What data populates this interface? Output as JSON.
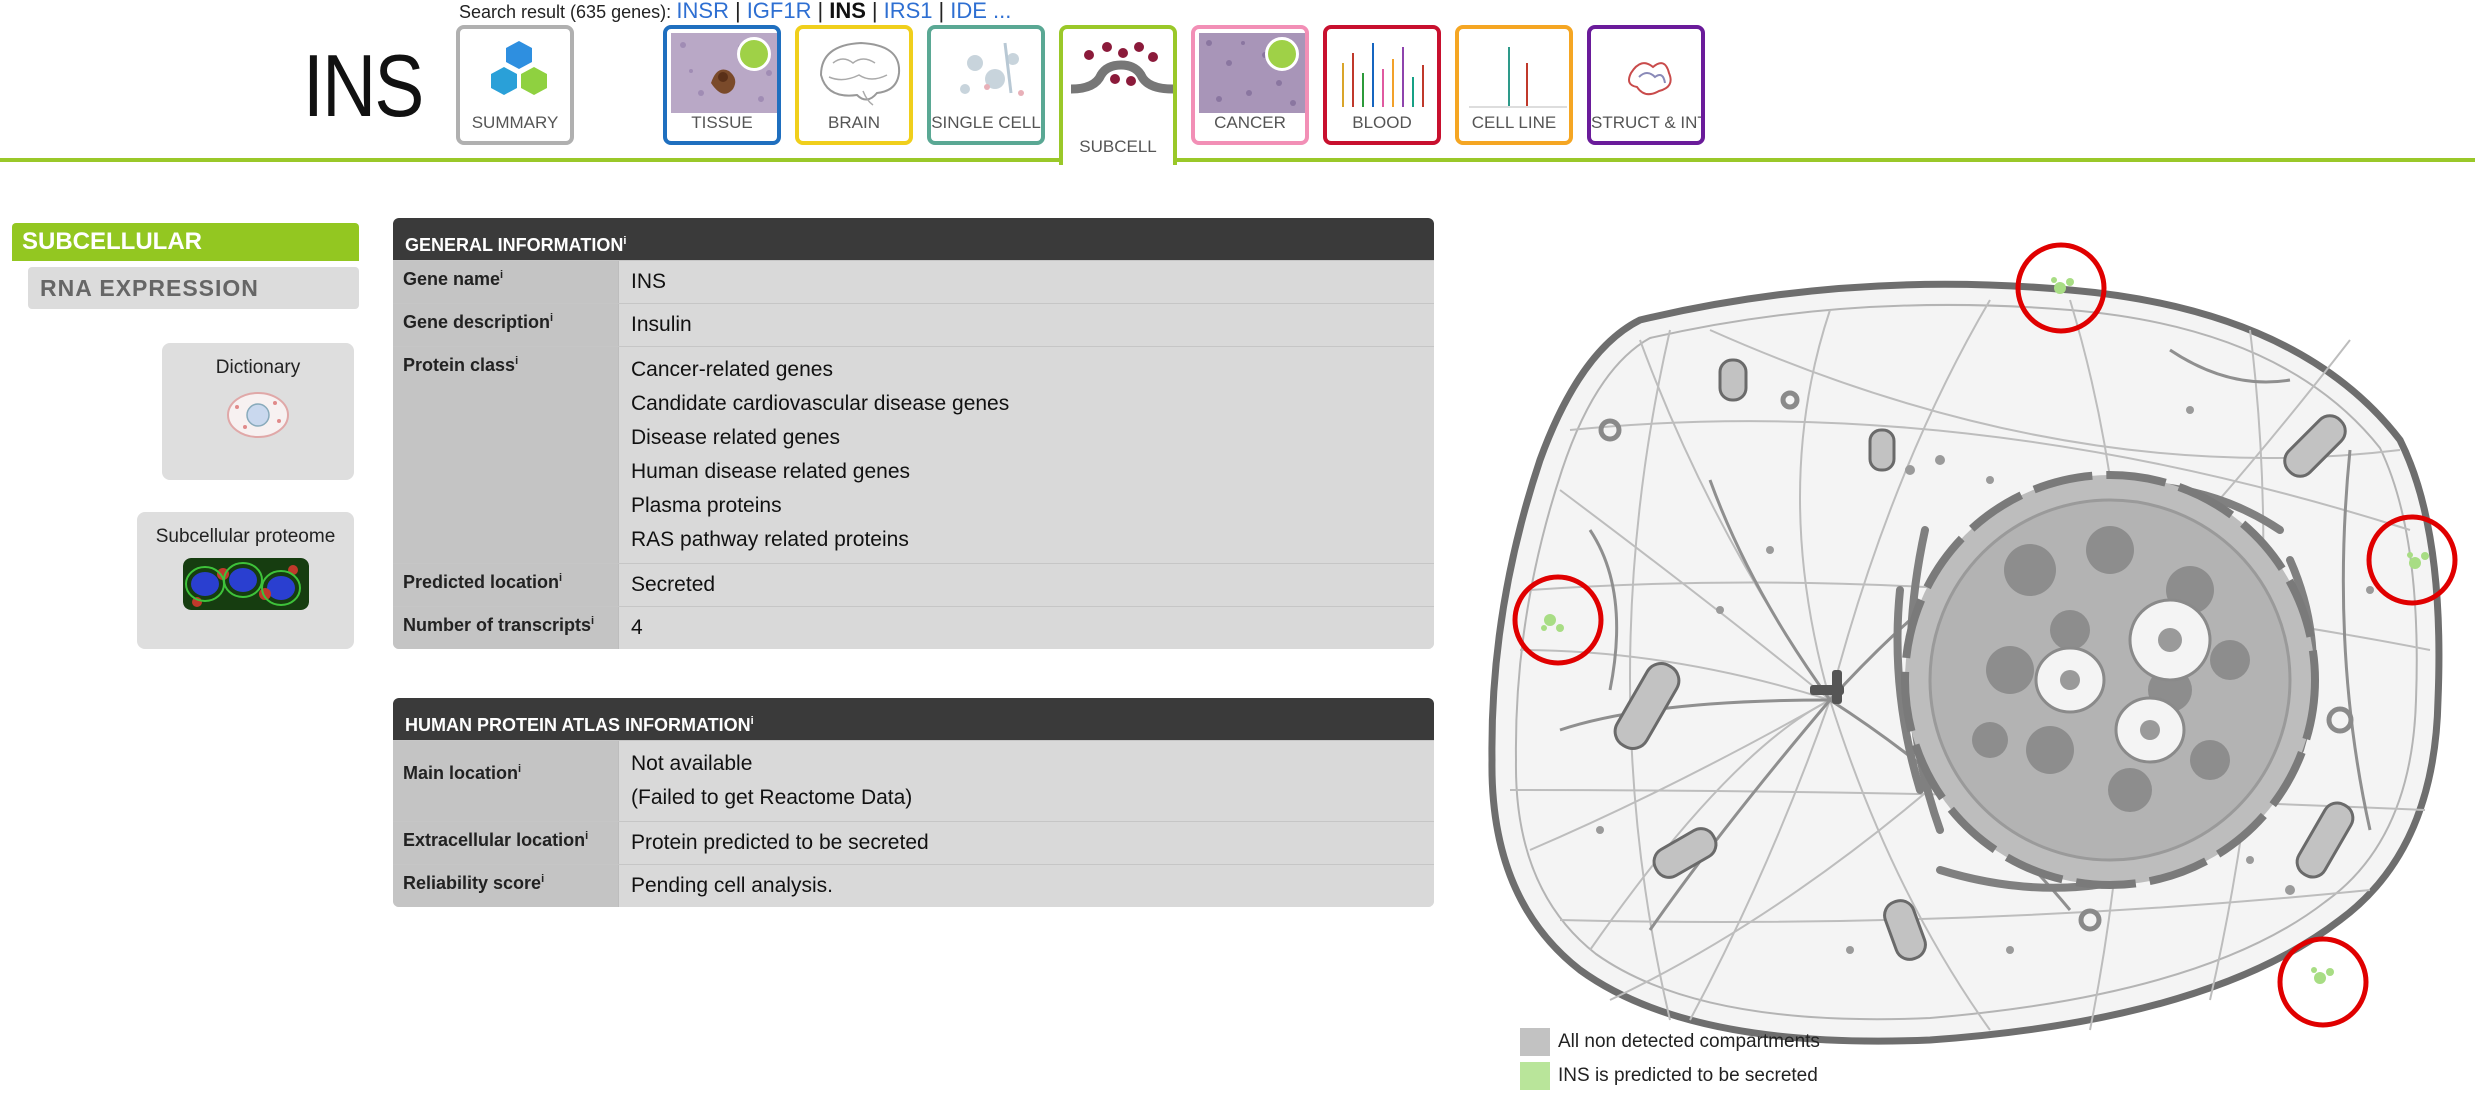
{
  "search": {
    "label": "Search result (635 genes):",
    "results": [
      "INSR",
      "IGF1R",
      "INS",
      "IRS1",
      "IDE ..."
    ],
    "current": "INS"
  },
  "gene": {
    "symbol": "INS"
  },
  "tabs": [
    {
      "id": "summary",
      "label": "SUMMARY",
      "color": "#b0b0b0"
    },
    {
      "id": "tissue",
      "label": "TISSUE",
      "color": "#1f6fbf"
    },
    {
      "id": "brain",
      "label": "BRAIN",
      "color": "#f0cf1c"
    },
    {
      "id": "single_cell",
      "label": "SINGLE CELL",
      "color": "#5aa894"
    },
    {
      "id": "subcell",
      "label": "SUBCELL",
      "color": "#9ac829"
    },
    {
      "id": "cancer",
      "label": "CANCER",
      "color": "#f28fb6"
    },
    {
      "id": "blood",
      "label": "BLOOD",
      "color": "#c8102e"
    },
    {
      "id": "cell_line",
      "label": "CELL LINE",
      "color": "#f5a623"
    },
    {
      "id": "struct_int",
      "label": "STRUCT & INT",
      "color": "#6a1b9a"
    }
  ],
  "sidebar": {
    "active": "SUBCELLULAR",
    "item": "RNA EXPRESSION",
    "dictionary": "Dictionary",
    "proteome": "Subcellular proteome"
  },
  "general": {
    "title": "GENERAL INFORMATION",
    "gene_name_label": "Gene name",
    "gene_name": "INS",
    "gene_desc_label": "Gene description",
    "gene_desc": "Insulin",
    "protein_class_label": "Protein class",
    "protein_class": [
      "Cancer-related genes",
      "Candidate cardiovascular disease genes",
      "Disease related genes",
      "Human disease related genes",
      "Plasma proteins",
      "RAS pathway related proteins"
    ],
    "predicted_label": "Predicted location",
    "predicted": "Secreted",
    "transcripts_label": "Number of transcripts",
    "transcripts": "4"
  },
  "hpa": {
    "title": "HUMAN PROTEIN ATLAS INFORMATION",
    "main_label": "Main location",
    "main_1": "Not available",
    "main_2": "(Failed to get Reactome Data)",
    "extra_label": "Extracellular location",
    "extra": "Protein predicted to be secreted",
    "rel_label": "Reliability score",
    "rel": "Pending cell analysis."
  },
  "legend": {
    "non_detected": "All non detected compartments",
    "secreted": "INS is predicted to be secreted",
    "non_detected_color": "#c2c2c2",
    "secreted_color": "#b9e59a"
  },
  "colors": {
    "accent": "#93c721",
    "link": "#2e6fd2",
    "circle": "#e00000"
  }
}
